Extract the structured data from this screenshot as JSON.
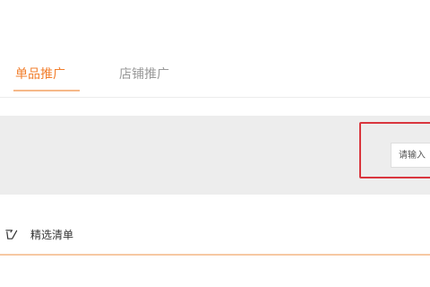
{
  "tabs": {
    "items": [
      {
        "label": "单品推广"
      },
      {
        "label": "店铺推广"
      }
    ]
  },
  "search": {
    "placeholder": "请输入"
  },
  "filter": {
    "label": "精选清单",
    "icon": "pencil-edit-icon"
  },
  "colors": {
    "accent": "#f27f2e",
    "highlight": "#d9363e",
    "band": "#ededed"
  }
}
